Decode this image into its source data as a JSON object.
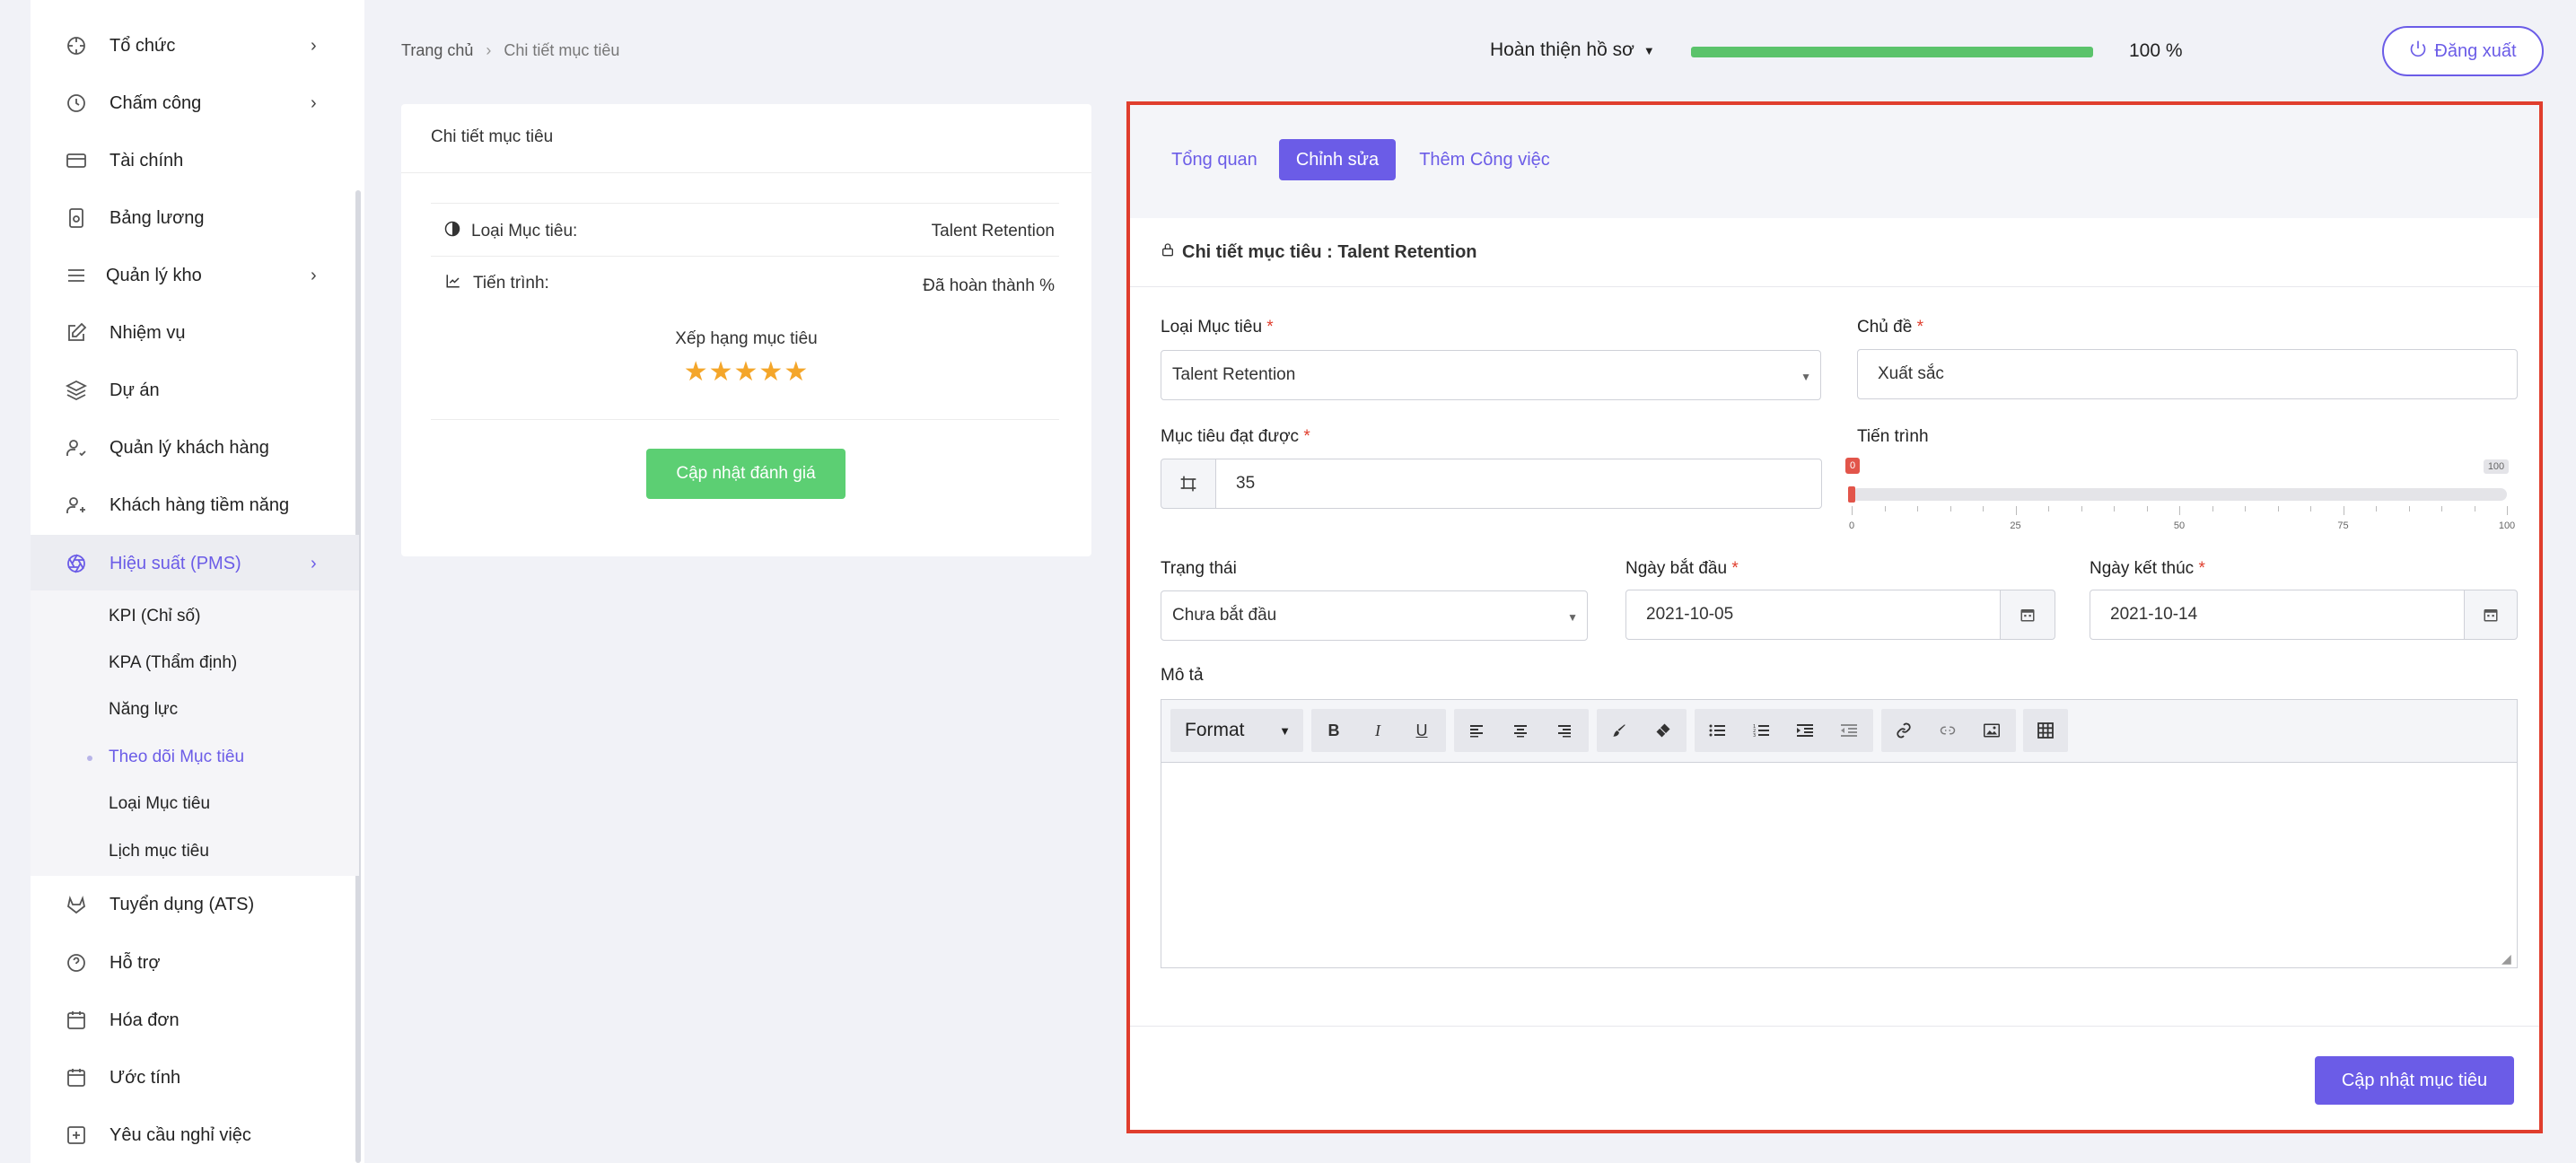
{
  "sidebar": {
    "items": [
      {
        "label": "Tổ chức",
        "icon": "crosshair-icon",
        "has_children": true
      },
      {
        "label": "Chấm công",
        "icon": "clock-icon",
        "has_children": true
      },
      {
        "label": "Tài chính",
        "icon": "credit-card-icon",
        "has_children": false
      },
      {
        "label": "Bảng lương",
        "icon": "payslip-icon",
        "has_children": false
      },
      {
        "label": "Quản lý kho",
        "icon": "menu-lines-icon",
        "has_children": true
      },
      {
        "label": "Nhiệm vụ",
        "icon": "edit-icon",
        "has_children": false
      },
      {
        "label": "Dự án",
        "icon": "layers-icon",
        "has_children": false
      },
      {
        "label": "Quản lý khách hàng",
        "icon": "user-check-icon",
        "has_children": false
      },
      {
        "label": "Khách hàng tiềm năng",
        "icon": "user-plus-icon",
        "has_children": false
      },
      {
        "label": "Hiệu suất (PMS)",
        "icon": "aperture-icon",
        "has_children": true,
        "active": true
      },
      {
        "label": "Tuyển dụng (ATS)",
        "icon": "gitlab-icon",
        "has_children": false
      },
      {
        "label": "Hỗ trợ",
        "icon": "help-circle-icon",
        "has_children": false
      },
      {
        "label": "Hóa đơn",
        "icon": "calendar-icon",
        "has_children": false
      },
      {
        "label": "Ước tính",
        "icon": "calendar-icon",
        "has_children": false
      },
      {
        "label": "Yêu cầu nghỉ việc",
        "icon": "plus-square-icon",
        "has_children": false
      }
    ],
    "submenu": [
      {
        "label": "KPI (Chỉ số)"
      },
      {
        "label": "KPA (Thẩm định)"
      },
      {
        "label": "Năng lực"
      },
      {
        "label": "Theo dõi Mục tiêu",
        "active": true
      },
      {
        "label": "Loại Mục tiêu"
      },
      {
        "label": "Lịch mục tiêu"
      }
    ]
  },
  "breadcrumb": {
    "home": "Trang chủ",
    "separator": "›",
    "current": "Chi tiết mục tiêu"
  },
  "header": {
    "profile_label": "Hoàn thiện hồ sơ",
    "progress_value": 100,
    "progress_text": "100 %",
    "logout_label": "Đăng xuất"
  },
  "left_card": {
    "title": "Chi tiết mục tiêu",
    "type_label": "Loại Mục tiêu:",
    "type_value": "Talent Retention",
    "progress_label": "Tiến trình:",
    "progress_value": "Đã hoàn thành %",
    "rating_title": "Xếp hạng mục tiêu",
    "stars": "★★★★★",
    "rating_count": 5,
    "update_rating_label": "Cập nhật đánh giá"
  },
  "tabs": [
    {
      "label": "Tổng quan",
      "active": false
    },
    {
      "label": "Chỉnh sửa",
      "active": true
    },
    {
      "label": "Thêm Công việc",
      "active": false
    }
  ],
  "form": {
    "section_title": "Chi tiết mục tiêu : Talent Retention",
    "goal_type_label": "Loại Mục tiêu",
    "goal_type_value": "Talent Retention",
    "subject_label": "Chủ đề",
    "subject_value": "Xuất sắc",
    "achieved_label": "Mục tiêu đạt được",
    "achieved_value": "35",
    "progress_label": "Tiến trình",
    "progress_value": 0,
    "progress_min": "0",
    "progress_max": "100",
    "tick_labels": [
      "0",
      "25",
      "50",
      "75",
      "100"
    ],
    "status_label": "Trạng thái",
    "status_value": "Chưa bắt đầu",
    "start_label": "Ngày bắt đầu",
    "start_value": "2021-10-05",
    "end_label": "Ngày kết thúc",
    "end_value": "2021-10-14",
    "description_label": "Mô tả",
    "format_label": "Format",
    "required_mark": "*",
    "submit_label": "Cập nhật mục tiêu"
  },
  "colors": {
    "accent": "#6b5ce7",
    "success": "#5ccf73",
    "highlight_border": "#e03e2d",
    "star": "#f4a62a"
  }
}
